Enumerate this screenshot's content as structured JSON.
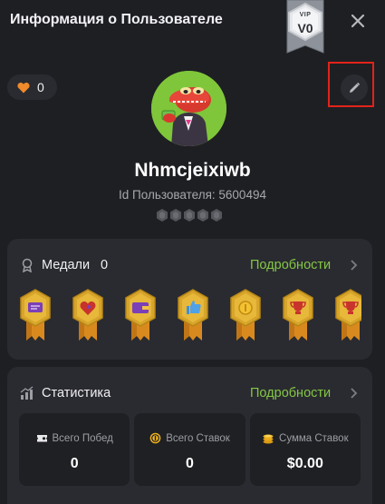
{
  "header": {
    "title": "Информация о Пользователе",
    "vip_label": "VIP",
    "vip_level": "V0"
  },
  "profile": {
    "likes": "0",
    "username": "Nhmcjeixiwb",
    "user_id_text": "Id Пользователя: 5600494",
    "rank_stars": 5
  },
  "medals": {
    "title": "Медали",
    "count": "0",
    "more_label": "Подробности",
    "items": [
      "message-medal-icon",
      "heart-medal-icon",
      "wallet-medal-icon",
      "like-medal-icon",
      "coin-medal-icon",
      "trophy-medal-icon",
      "trophy-medal-icon"
    ]
  },
  "stats": {
    "title": "Статистика",
    "more_label": "Подробности",
    "boxes": [
      {
        "label": "Всего Побед",
        "value": "0",
        "icon": "ticket-icon"
      },
      {
        "label": "Всего Ставок",
        "value": "0",
        "icon": "coin-icon"
      },
      {
        "label": "Сумма Ставок",
        "value": "$0.00",
        "icon": "coin-stack-icon"
      }
    ]
  },
  "colors": {
    "background": "#1e1f23",
    "card": "#2a2b30",
    "accent_green": "#83c645",
    "medal_gold": "#d7a52b",
    "highlight_red": "#e2231a"
  }
}
